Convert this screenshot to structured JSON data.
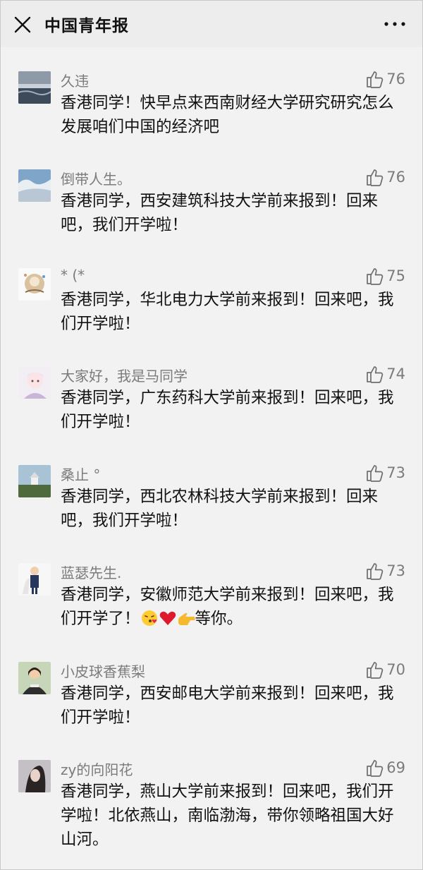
{
  "header": {
    "title": "中国青年报"
  },
  "comments": [
    {
      "name": "久违",
      "likes": "76",
      "text": "香港同学！快早点来西南财经大学研究研究怎么发展咱们中国的经济吧"
    },
    {
      "name": "倒带人生。",
      "likes": "76",
      "text": "香港同学，西安建筑科技大学前来报到！回来吧，我们开学啦！"
    },
    {
      "name": "* (*",
      "likes": "75",
      "text": "香港同学，华北电力大学前来报到！回来吧，我们开学啦！"
    },
    {
      "name": "大家好，我是马同学",
      "likes": "74",
      "text": "香港同学，广东药科大学前来报到！回来吧，我们开学啦！"
    },
    {
      "name": "桑止 °",
      "likes": "73",
      "text": "香港同学，西北农林科技大学前来报到！回来吧，我们开学啦！"
    },
    {
      "name": "蓝瑟先生.",
      "likes": "73",
      "text_before": "香港同学，安徽师范大学前来报到！回来吧，我们开学了！",
      "text_after": "等你。",
      "emojis": [
        "kiss-emoji",
        "heart-emoji",
        "pointing-hand-emoji"
      ]
    },
    {
      "name": "小皮球香蕉梨",
      "likes": "70",
      "text": "香港同学，西安邮电大学前来报到！回来吧，我们开学啦！"
    },
    {
      "name": "zy的向阳花",
      "likes": "69",
      "text": "香港同学，燕山大学前来报到！回来吧，我们开学啦！北依燕山，南临渤海，带你领略祖国大好山河。"
    }
  ]
}
